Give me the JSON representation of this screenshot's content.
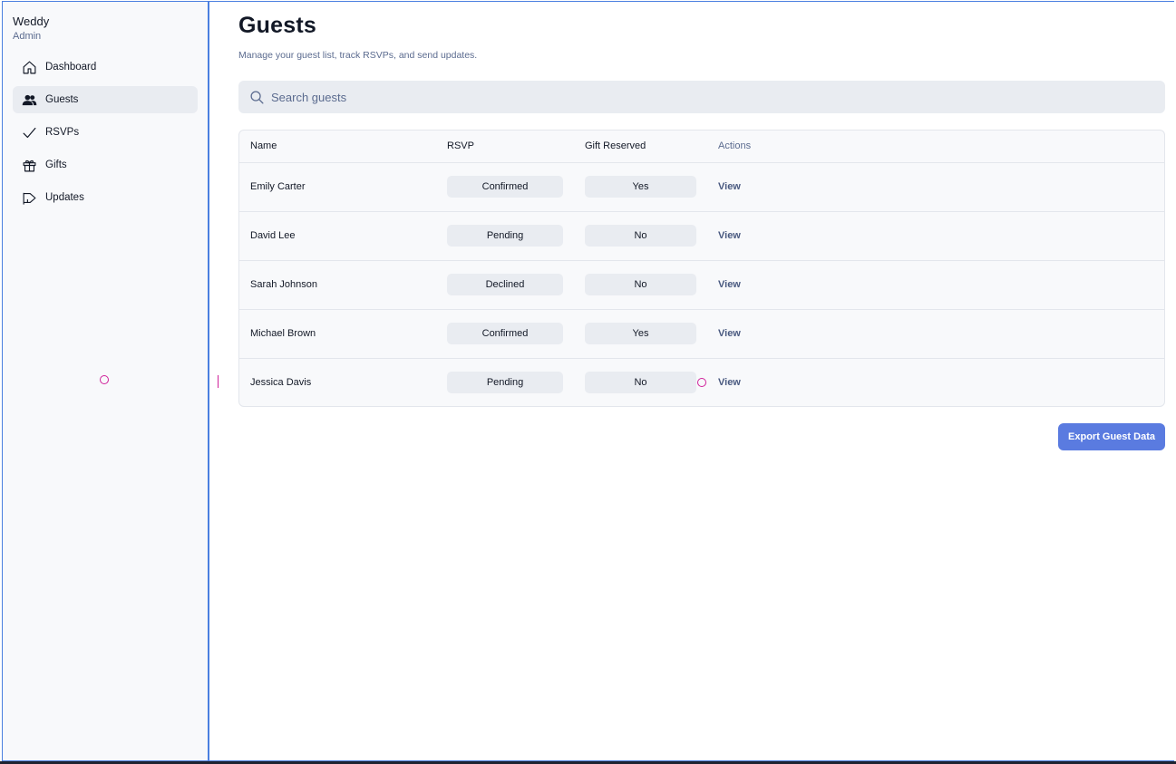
{
  "app": {
    "name": "Weddy",
    "role": "Admin"
  },
  "sidebar": {
    "items": [
      {
        "label": "Dashboard",
        "icon": "home-icon"
      },
      {
        "label": "Guests",
        "icon": "users-icon",
        "active": true
      },
      {
        "label": "RSVPs",
        "icon": "check-icon"
      },
      {
        "label": "Gifts",
        "icon": "gift-icon"
      },
      {
        "label": "Updates",
        "icon": "megaphone-icon"
      }
    ]
  },
  "page": {
    "title": "Guests",
    "subtitle": "Manage your guest list, track RSVPs, and send updates."
  },
  "search": {
    "placeholder": "Search guests",
    "value": ""
  },
  "table": {
    "headers": {
      "name": "Name",
      "rsvp": "RSVP",
      "gift": "Gift Reserved",
      "actions": "Actions"
    },
    "rows": [
      {
        "name": "Emily Carter",
        "rsvp": "Confirmed",
        "gift": "Yes",
        "action": "View"
      },
      {
        "name": "David Lee",
        "rsvp": "Pending",
        "gift": "No",
        "action": "View"
      },
      {
        "name": "Sarah Johnson",
        "rsvp": "Declined",
        "gift": "No",
        "action": "View"
      },
      {
        "name": "Michael Brown",
        "rsvp": "Confirmed",
        "gift": "Yes",
        "action": "View"
      },
      {
        "name": "Jessica Davis",
        "rsvp": "Pending",
        "gift": "No",
        "action": "View"
      }
    ]
  },
  "export_button": {
    "label": "Export Guest Data"
  },
  "colors": {
    "accent": "#5a7be0",
    "frame": "#4a7fe0",
    "pill_bg": "#e9ecf1",
    "muted_text": "#5b6b8f",
    "cursor_marker": "#d0209a"
  }
}
